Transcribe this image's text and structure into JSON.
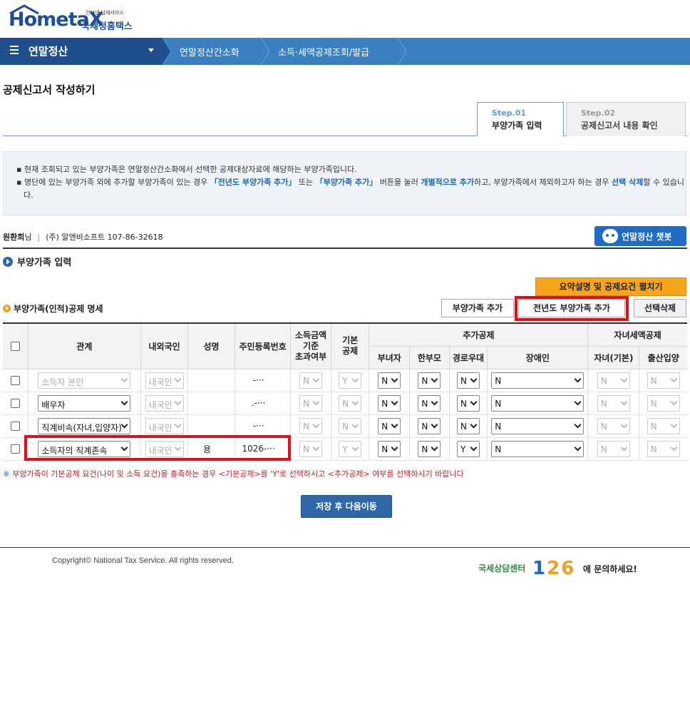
{
  "header": {
    "logo_text": "HometaX",
    "logo_tagline": "인터넷 납세서비스",
    "logo_sub": "국세청홈택스"
  },
  "nav": {
    "menu_label": "연말정산",
    "crumbs": [
      "연말정산간소화",
      "소득·세액공제조회/발급"
    ]
  },
  "page": {
    "title": "공제신고서 작성하기",
    "tabs": [
      {
        "step": "Step.01",
        "name": "부양가족 입력"
      },
      {
        "step": "Step.02",
        "name": "공제신고서 내용 확인"
      }
    ]
  },
  "notice": {
    "line1": "현재 조회되고 있는 부양가족은 연말정산간소화에서 선택한 공제대상자료에 해당하는 부양가족입니다.",
    "line2_a": "명단에 있는 부양가족 외에 추가할 부양가족이 있는 경우 ",
    "line2_hl1": "「전년도 부양가족 추가」",
    "line2_b": " 또는 ",
    "line2_hl2": "「부양가족 추가」",
    "line2_c": " 버튼을 눌러 ",
    "line2_hl3": "개별적으로 추가",
    "line2_d": "하고, 부양가족에서 제외하고자 하는 경우 ",
    "line2_hl4": "선택 삭제",
    "line2_e": "할 수 있습니다."
  },
  "user": {
    "name": "원환희",
    "suffix": "님",
    "separator": "|",
    "company": "(주) 알앤비소프트 107-86-32618",
    "chatbot_label": "연말정산 챗봇"
  },
  "section": {
    "title": "부양가족 입력",
    "summary_button": "요약설명 및 공제요건 펼치기",
    "sub_title": "부양가족(인적)공제 명세",
    "add_button": "부양가족 추가",
    "prev_year_button": "전년도 부양가족 추가",
    "delete_button": "선택삭제"
  },
  "table": {
    "headers": {
      "relation": "관계",
      "nationality": "내외국인",
      "name": "성명",
      "resident_no": "주민등록번호",
      "income_over_1": "소득금액",
      "income_over_2": "기준",
      "income_over_3": "초과여부",
      "basic_1": "기본",
      "basic_2": "공제",
      "extra": "추가공제",
      "woman": "부녀자",
      "single_parent": "한부모",
      "elderly": "경로우대",
      "disabled": "장애인",
      "child_tax": "자녀세액공제",
      "child_basic": "자녀(기본)",
      "birth_adopt": "출산입양"
    },
    "rows": [
      {
        "relation": "소득자 본인",
        "nationality": "내국인",
        "name": "",
        "resident_no": "-···",
        "income_over": "N",
        "basic": "Y",
        "woman": "N",
        "single_parent": "N",
        "elderly": "N",
        "disabled": "N",
        "child_basic": "N",
        "birth_adopt": "N"
      },
      {
        "relation": "배우자",
        "nationality": "내국인",
        "name": "",
        "resident_no": ".-···",
        "income_over": "N",
        "basic": "N",
        "woman": "N",
        "single_parent": "N",
        "elderly": "N",
        "disabled": "N",
        "child_basic": "N",
        "birth_adopt": "N"
      },
      {
        "relation": "직계비속(자녀,입양자)",
        "nationality": "내국인",
        "name": "",
        "resident_no": "-···",
        "income_over": "N",
        "basic": "N",
        "woman": "N",
        "single_parent": "N",
        "elderly": "N",
        "disabled": "N",
        "child_basic": "N",
        "birth_adopt": "N"
      },
      {
        "relation": "소득자의 직계존속",
        "nationality": "내국인",
        "name": "용",
        "resident_no": "1026-···",
        "income_over": "N",
        "basic": "Y",
        "woman": "N",
        "single_parent": "N",
        "elderly": "Y",
        "disabled": "N",
        "child_basic": "N",
        "birth_adopt": "N"
      }
    ]
  },
  "note": {
    "mark": "※",
    "text": "부양가족이 기본공제 요건(나이 및 소득 요건)을 충족하는 경우 <기본공제>를 'Y'로 선택하시고 <추가공제> 여부를 선택하시기 바랍니다"
  },
  "save_button": "저장 후 다음이동",
  "footer": {
    "copyright": "Copyright© National Tax Service. All rights reserved.",
    "center_text": "국세상담센터",
    "center_num_a": "1",
    "center_num_b": "2",
    "center_num_c": "6",
    "center_suffix": "에 문의하세요!"
  },
  "colors": {
    "nav_dark": "#1f4f8c",
    "nav_light": "#3a7fc0",
    "highlight_red": "#e0101a",
    "accent_orange": "#f7a51c"
  }
}
